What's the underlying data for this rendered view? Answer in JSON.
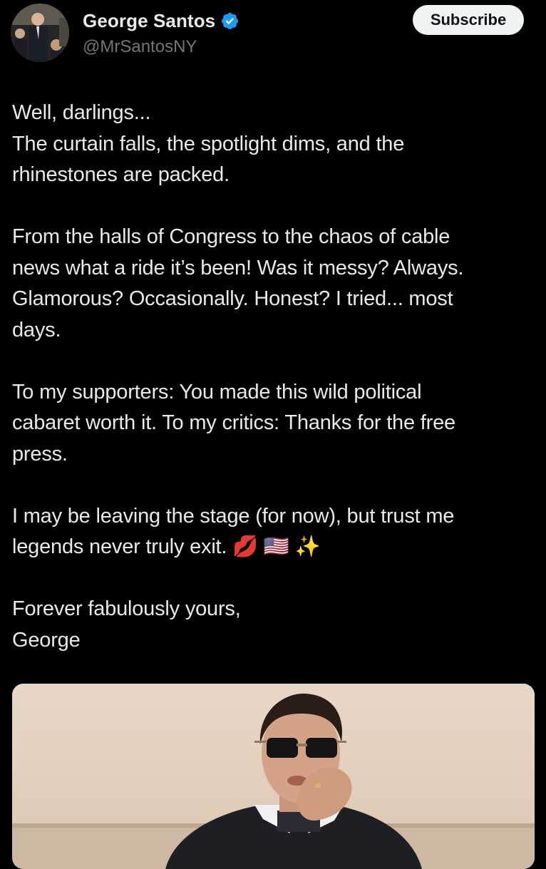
{
  "author": {
    "display_name": "George Santos",
    "handle": "@MrSantosNY",
    "verified": true,
    "avatar_icon": "profile-photo-avatar"
  },
  "actions": {
    "subscribe_label": "Subscribe"
  },
  "tweet": {
    "paragraphs": [
      [
        "Well, darlings...",
        "The curtain falls, the spotlight dims, and the",
        "rhinestones are packed."
      ],
      [
        "From the halls of Congress to the chaos of cable",
        "news what a ride it’s been! Was it messy? Always.",
        "Glamorous? Occasionally. Honest? I tried... most",
        "days."
      ],
      [
        "To my supporters: You made this wild political",
        "cabaret worth it. To my critics: Thanks for the free",
        "press."
      ],
      [
        "I may be leaving the stage (for now), but trust me",
        "legends never truly exit. 💋 🇺🇸 ✨"
      ],
      [
        "Forever fabulously yours,",
        "George"
      ]
    ]
  },
  "media": {
    "icon": "photo-man-sunglasses-blowing-kiss"
  },
  "colors": {
    "background": "#000000",
    "text_primary": "#e7e9ea",
    "text_secondary": "#71767b",
    "verified_blue": "#1d9bf0",
    "button_bg": "#eff3f4",
    "button_text": "#0f1419"
  }
}
